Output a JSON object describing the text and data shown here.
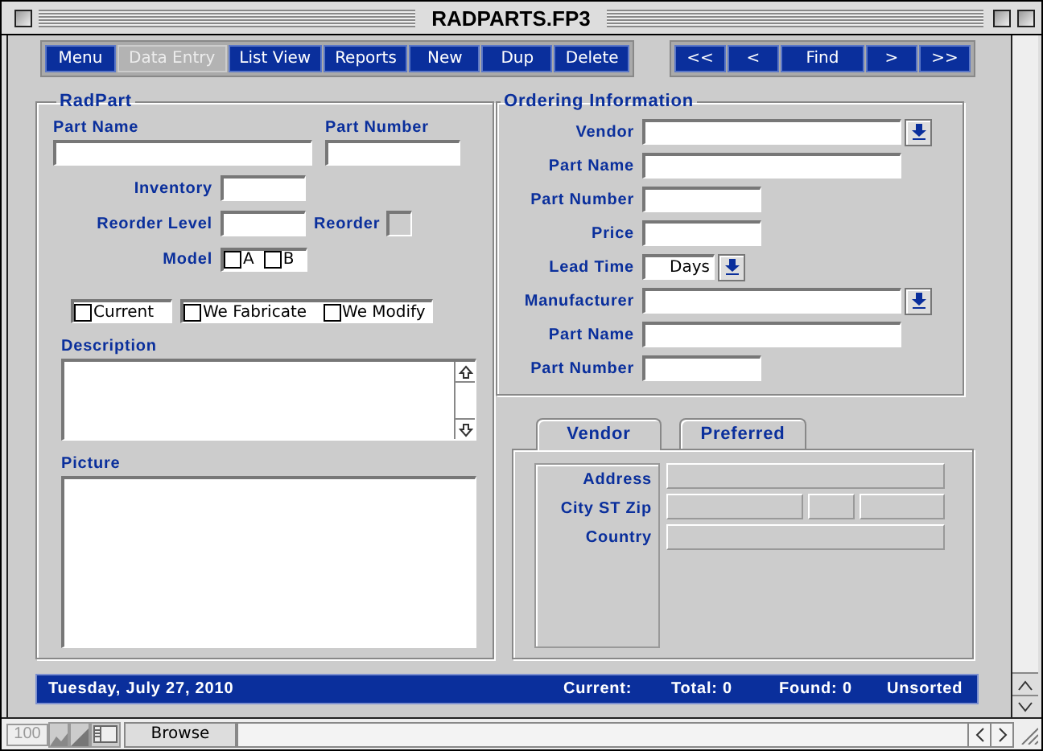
{
  "window": {
    "title": "RADPARTS.FP3"
  },
  "nav": {
    "left": [
      {
        "label": "Menu",
        "selected": false
      },
      {
        "label": "Data Entry",
        "selected": true
      },
      {
        "label": "List View",
        "selected": false
      },
      {
        "label": "Reports",
        "selected": false
      },
      {
        "label": "New",
        "selected": false
      },
      {
        "label": "Dup",
        "selected": false
      },
      {
        "label": "Delete",
        "selected": false
      }
    ],
    "right": [
      {
        "label": "<<"
      },
      {
        "label": "<"
      },
      {
        "label": "Find"
      },
      {
        "label": ">"
      },
      {
        "label": ">>"
      }
    ]
  },
  "radpart": {
    "title": "RadPart",
    "part_name_label": "Part Name",
    "part_number_label": "Part Number",
    "inventory_label": "Inventory",
    "reorder_level_label": "Reorder Level",
    "reorder_label": "Reorder",
    "reorder_checked": false,
    "model_label": "Model",
    "models": [
      {
        "label": "A",
        "checked": false
      },
      {
        "label": "B",
        "checked": false
      }
    ],
    "flag_groups": [
      [
        {
          "label": "Current",
          "checked": false
        }
      ],
      [
        {
          "label": "We Fabricate",
          "checked": false
        },
        {
          "label": "We Modify",
          "checked": false
        }
      ]
    ],
    "description_label": "Description",
    "picture_label": "Picture"
  },
  "ordering": {
    "title": "Ordering Information",
    "rows": [
      {
        "label": "Vendor",
        "kind": "combo"
      },
      {
        "label": "Part Name",
        "kind": "wide"
      },
      {
        "label": "Part Number",
        "kind": "narrow"
      },
      {
        "label": "Price",
        "kind": "narrow"
      },
      {
        "label": "Lead Time",
        "kind": "unit",
        "value": "Days"
      },
      {
        "label": "Manufacturer",
        "kind": "combo"
      },
      {
        "label": "Part Name",
        "kind": "wide"
      },
      {
        "label": "Part Number",
        "kind": "narrow"
      }
    ]
  },
  "tabs": [
    {
      "label": "Vendor",
      "selected": true
    },
    {
      "label": "Preferred",
      "selected": false
    }
  ],
  "vendor": {
    "rows": [
      {
        "label": "Address",
        "kind": "single"
      },
      {
        "label": "City ST Zip",
        "kind": "triple"
      },
      {
        "label": "Country",
        "kind": "single"
      }
    ]
  },
  "status_bar": {
    "date": "Tuesday, July 27, 2010",
    "current": "Current:",
    "total": "Total: 0",
    "found": "Found: 0",
    "sort": "Unsorted"
  },
  "bottom_bar": {
    "zoom": "100",
    "mode": "Browse"
  }
}
